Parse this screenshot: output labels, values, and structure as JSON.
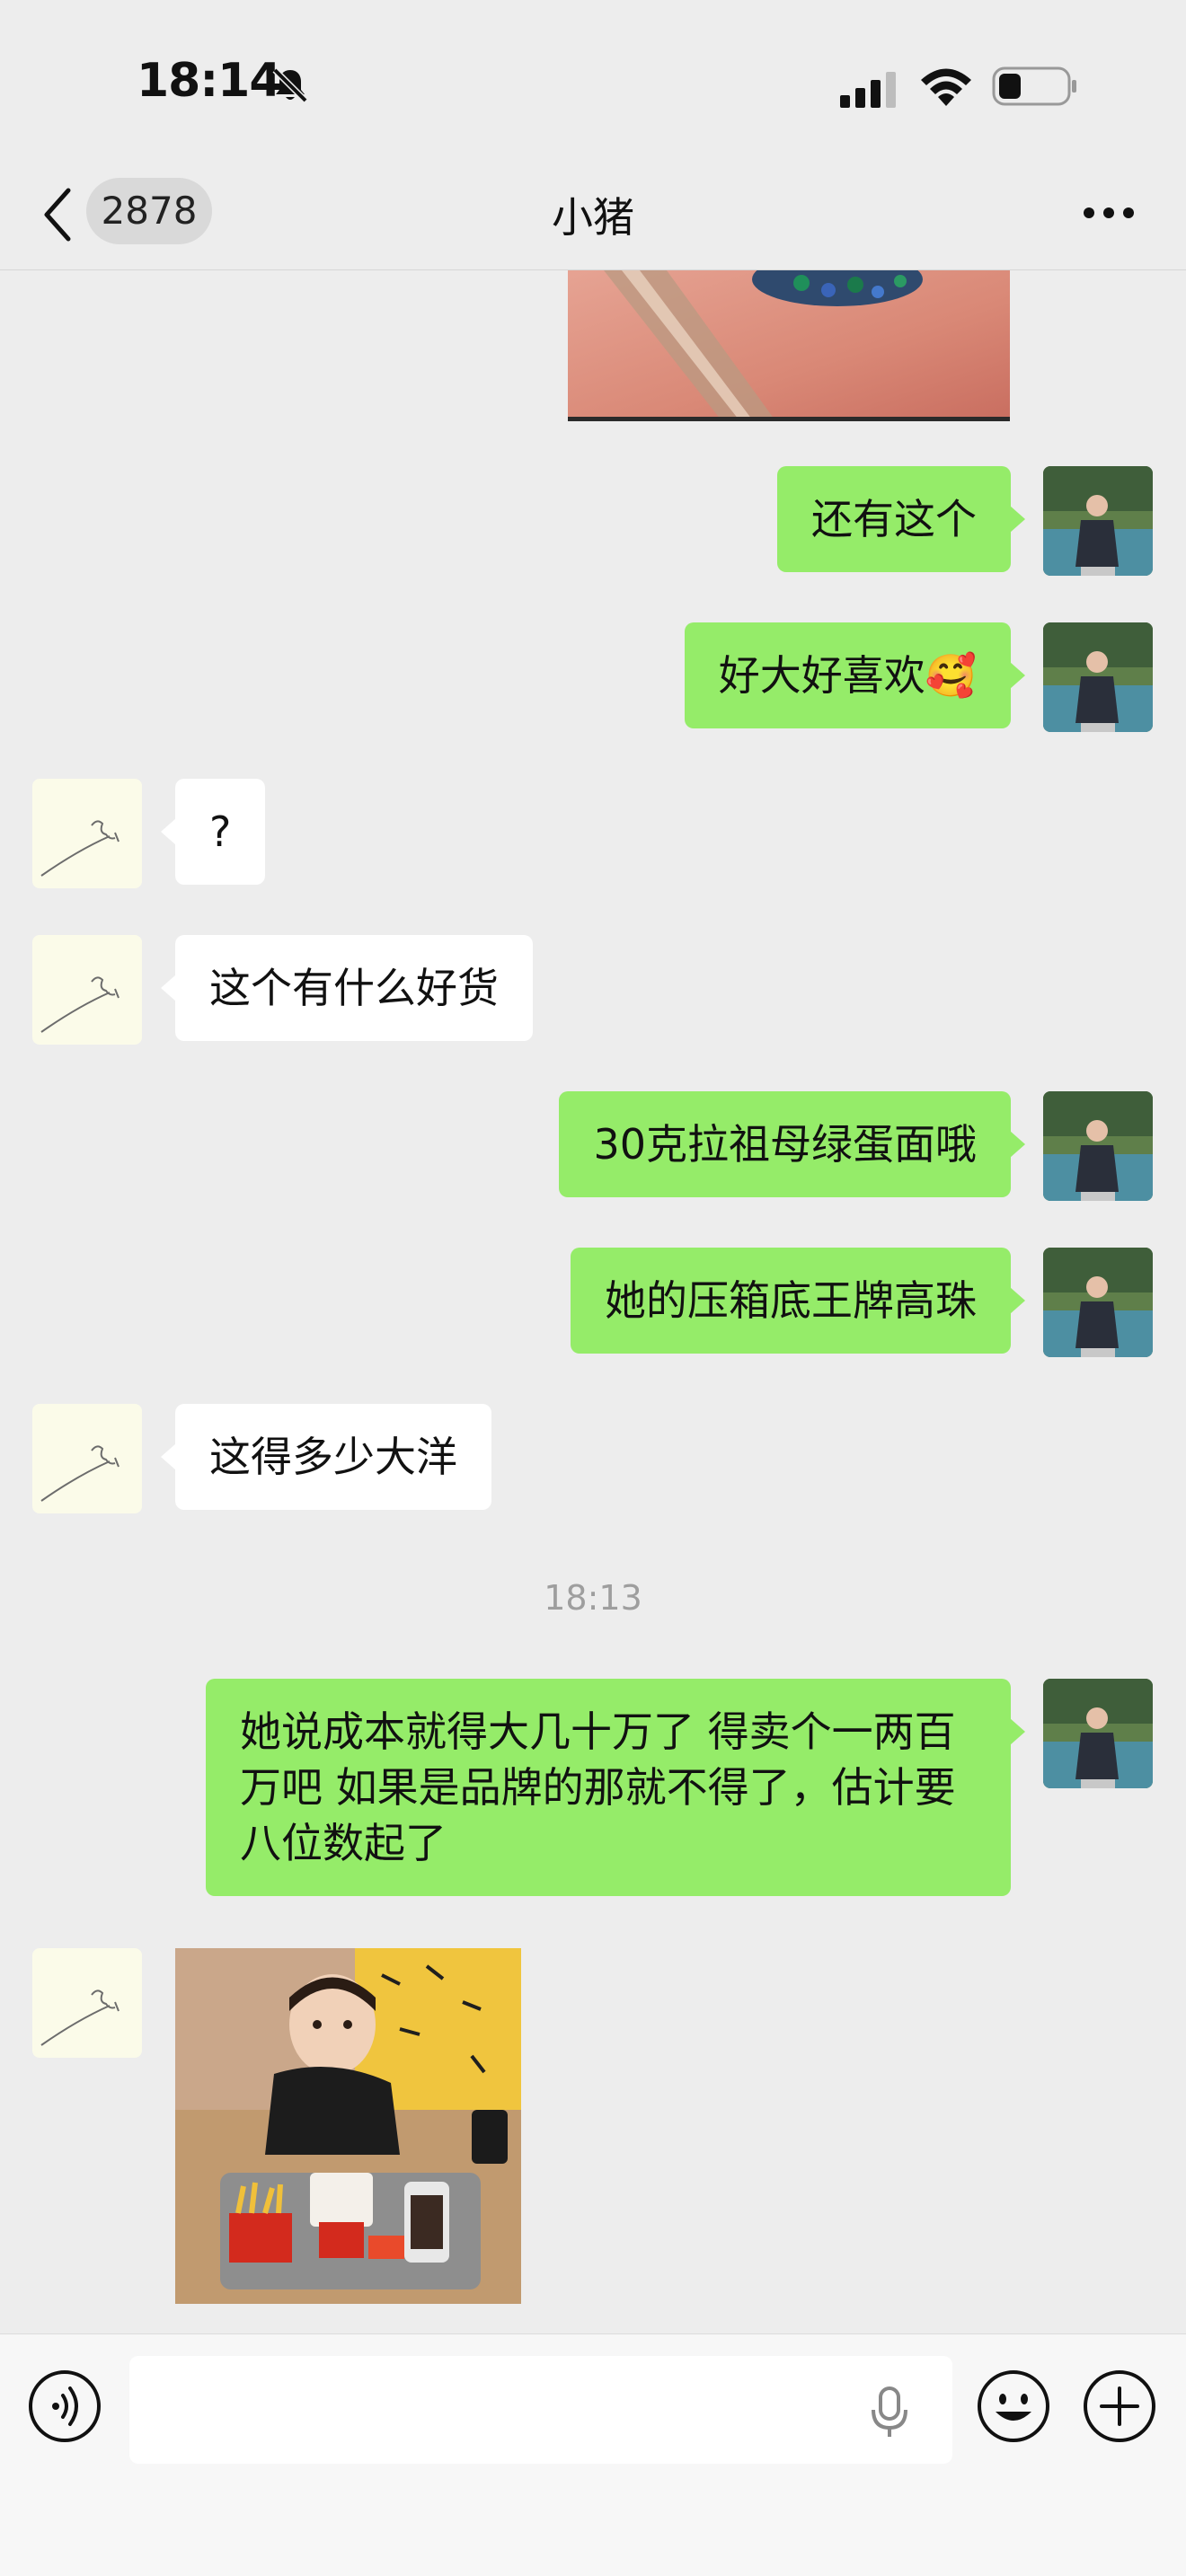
{
  "status_bar": {
    "time": "18:14"
  },
  "nav": {
    "unread_count": "2878",
    "title": "小猪"
  },
  "messages": [
    {
      "side": "me",
      "text": "还有这个"
    },
    {
      "side": "me",
      "text": "好大好喜欢🥰"
    },
    {
      "side": "them",
      "text": "?"
    },
    {
      "side": "them",
      "text": "这个有什么好货"
    },
    {
      "side": "me",
      "text": "30克拉祖母绿蛋面哦"
    },
    {
      "side": "me",
      "text": "她的压箱底王牌高珠"
    },
    {
      "side": "them",
      "text": "这得多少大洋"
    },
    {
      "timestamp": "18:13"
    },
    {
      "side": "me",
      "text": "她说成本就得大几十万了 得卖个一两百万吧 如果是品牌的那就不得了，估计要八位数起了"
    },
    {
      "side": "them",
      "type": "image"
    }
  ],
  "colors": {
    "my_bubble": "#95ec69",
    "their_bubble": "#ffffff",
    "background": "#ededed"
  }
}
